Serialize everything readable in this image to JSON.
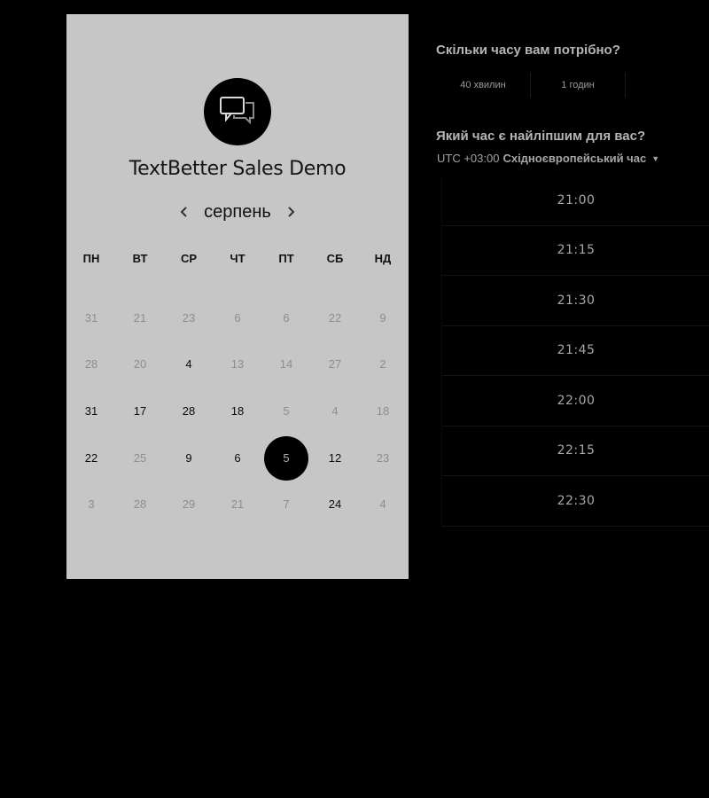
{
  "app": {
    "title": "TextBetter Sales Demo",
    "logo_icon": "chat-bubbles-icon"
  },
  "calendar": {
    "month": "серпень",
    "prev_icon": "chevron-left-icon",
    "next_icon": "chevron-right-icon",
    "weekdays": [
      "ПН",
      "ВТ",
      "СР",
      "ЧТ",
      "ПТ",
      "СБ",
      "НД"
    ],
    "weeks": [
      [
        {
          "d": "31",
          "s": "muted"
        },
        {
          "d": "21",
          "s": "muted"
        },
        {
          "d": "23",
          "s": "muted"
        },
        {
          "d": "6",
          "s": "muted"
        },
        {
          "d": "6",
          "s": "muted"
        },
        {
          "d": "22",
          "s": "muted"
        },
        {
          "d": "9",
          "s": "muted"
        }
      ],
      [
        {
          "d": "28",
          "s": "muted"
        },
        {
          "d": "20",
          "s": "muted"
        },
        {
          "d": "4",
          "s": "active"
        },
        {
          "d": "13",
          "s": "muted"
        },
        {
          "d": "14",
          "s": "muted"
        },
        {
          "d": "27",
          "s": "muted"
        },
        {
          "d": "2",
          "s": "muted"
        }
      ],
      [
        {
          "d": "31",
          "s": "active"
        },
        {
          "d": "17",
          "s": "active"
        },
        {
          "d": "28",
          "s": "active"
        },
        {
          "d": "18",
          "s": "active"
        },
        {
          "d": "5",
          "s": "muted"
        },
        {
          "d": "4",
          "s": "muted"
        },
        {
          "d": "18",
          "s": "muted"
        }
      ],
      [
        {
          "d": "22",
          "s": "active"
        },
        {
          "d": "25",
          "s": "muted"
        },
        {
          "d": "9",
          "s": "active"
        },
        {
          "d": "6",
          "s": "active"
        },
        {
          "d": "5",
          "s": "selected"
        },
        {
          "d": "12",
          "s": "active"
        },
        {
          "d": "23",
          "s": "muted"
        }
      ],
      [
        {
          "d": "3",
          "s": "muted"
        },
        {
          "d": "28",
          "s": "muted"
        },
        {
          "d": "29",
          "s": "muted"
        },
        {
          "d": "21",
          "s": "muted"
        },
        {
          "d": "7",
          "s": "muted"
        },
        {
          "d": "24",
          "s": "active"
        },
        {
          "d": "4",
          "s": "muted"
        }
      ]
    ]
  },
  "duration": {
    "question": "Скільки часу вам потрібно?",
    "options": [
      "40 хвилин",
      "1 годин"
    ]
  },
  "time": {
    "question": "Який час є найліпшим для вас?",
    "timezone_offset": "UTC +03:00",
    "timezone_name": "Східноєвропейський час",
    "caret_icon": "caret-down-icon",
    "slots": [
      "21:00",
      "21:15",
      "21:30",
      "21:45",
      "22:00",
      "22:15",
      "22:30"
    ]
  },
  "colors": {
    "background": "#000000",
    "panel": "#c6c6c6",
    "selected_day": "#000000"
  }
}
